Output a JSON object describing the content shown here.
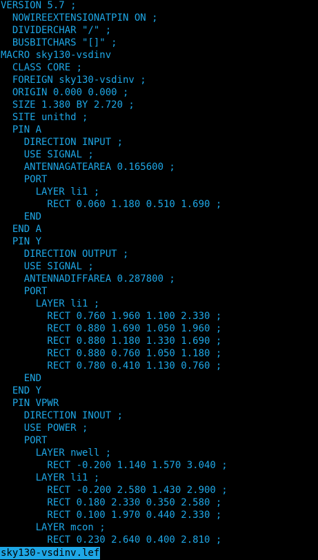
{
  "colors": {
    "background": "#000000",
    "text": "#1ea7e6",
    "status_bg": "#1ea7e6",
    "status_text": "#000000"
  },
  "file": {
    "lines": [
      "VERSION 5.7 ;",
      "  NOWIREEXTENSIONATPIN ON ;",
      "  DIVIDERCHAR \"/\" ;",
      "  BUSBITCHARS \"[]\" ;",
      "MACRO sky130-vsdinv",
      "  CLASS CORE ;",
      "  FOREIGN sky130-vsdinv ;",
      "  ORIGIN 0.000 0.000 ;",
      "  SIZE 1.380 BY 2.720 ;",
      "  SITE unithd ;",
      "  PIN A",
      "    DIRECTION INPUT ;",
      "    USE SIGNAL ;",
      "    ANTENNAGATEAREA 0.165600 ;",
      "    PORT",
      "      LAYER li1 ;",
      "        RECT 0.060 1.180 0.510 1.690 ;",
      "    END",
      "  END A",
      "  PIN Y",
      "    DIRECTION OUTPUT ;",
      "    USE SIGNAL ;",
      "    ANTENNADIFFAREA 0.287800 ;",
      "    PORT",
      "      LAYER li1 ;",
      "        RECT 0.760 1.960 1.100 2.330 ;",
      "        RECT 0.880 1.690 1.050 1.960 ;",
      "        RECT 0.880 1.180 1.330 1.690 ;",
      "        RECT 0.880 0.760 1.050 1.180 ;",
      "        RECT 0.780 0.410 1.130 0.760 ;",
      "    END",
      "  END Y",
      "  PIN VPWR",
      "    DIRECTION INOUT ;",
      "    USE POWER ;",
      "    PORT",
      "      LAYER nwell ;",
      "        RECT -0.200 1.140 1.570 3.040 ;",
      "      LAYER li1 ;",
      "        RECT -0.200 2.580 1.430 2.900 ;",
      "        RECT 0.180 2.330 0.350 2.580 ;",
      "        RECT 0.100 1.970 0.440 2.330 ;",
      "      LAYER mcon ;",
      "        RECT 0.230 2.640 0.400 2.810 ;"
    ]
  },
  "status_bar": {
    "filename": "sky130-vsdinv.lef"
  }
}
